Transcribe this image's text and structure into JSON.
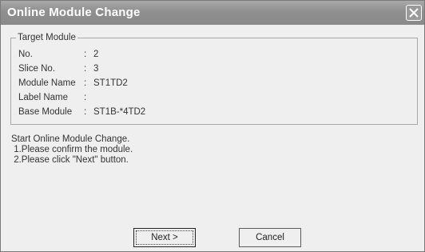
{
  "window": {
    "title": "Online Module Change"
  },
  "target_module": {
    "group_label": "Target Module",
    "rows": [
      {
        "label": "No.",
        "value": "2"
      },
      {
        "label": "Slice No.",
        "value": "3"
      },
      {
        "label": "Module Name",
        "value": "ST1TD2"
      },
      {
        "label": "Label Name",
        "value": ""
      },
      {
        "label": "Base Module",
        "value": "ST1B-*4TD2"
      }
    ]
  },
  "instructions": {
    "line1": "Start Online Module Change.",
    "line2": " 1.Please confirm the module.",
    "line3": " 2.Please click \"Next\" button."
  },
  "buttons": {
    "next_label": "Next >",
    "cancel_label": "Cancel"
  }
}
